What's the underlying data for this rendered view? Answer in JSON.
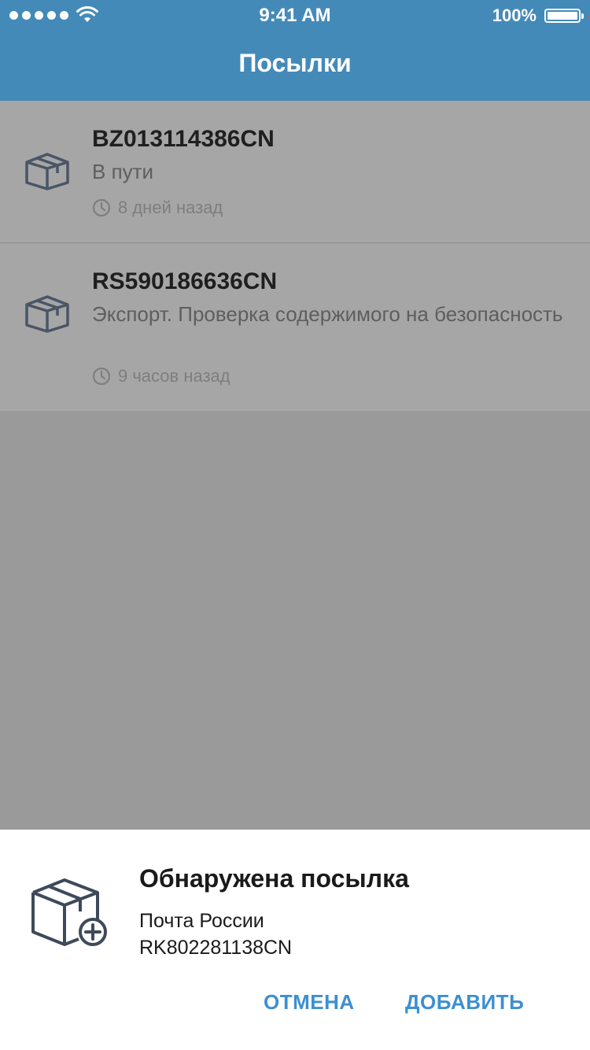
{
  "status_bar": {
    "time": "9:41 AM",
    "battery": "100%"
  },
  "header": {
    "title": "Посылки"
  },
  "parcels": [
    {
      "track": "BZ013114386CN",
      "status": "В пути",
      "when": "8 дней назад"
    },
    {
      "track": "RS590186636CN",
      "status": "Экспорт. Проверка содержимого на безопасность",
      "when": "9 часов назад"
    }
  ],
  "sheet": {
    "title": "Обнаружена посылка",
    "carrier": "Почта России",
    "track": "RK802281138CN",
    "cancel_label": "ОТМЕНА",
    "add_label": "ДОБАВИТЬ"
  },
  "colors": {
    "header_bg": "#448ab9",
    "accent": "#3d8fd1",
    "overlay": "#9a9a9a"
  },
  "icons": {
    "parcel": "package-box-icon",
    "clock": "clock-icon",
    "add_parcel": "package-add-icon"
  }
}
